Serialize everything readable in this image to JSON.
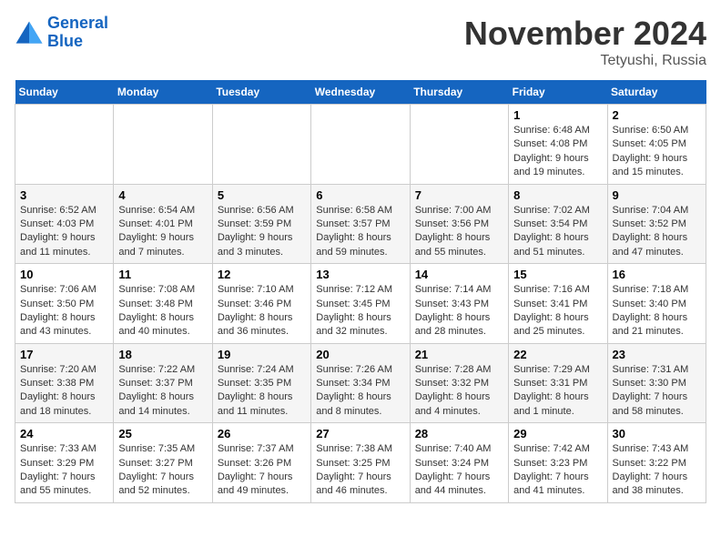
{
  "logo": {
    "line1": "General",
    "line2": "Blue"
  },
  "title": "November 2024",
  "location": "Tetyushi, Russia",
  "weekdays": [
    "Sunday",
    "Monday",
    "Tuesday",
    "Wednesday",
    "Thursday",
    "Friday",
    "Saturday"
  ],
  "weeks": [
    [
      {
        "day": "",
        "detail": ""
      },
      {
        "day": "",
        "detail": ""
      },
      {
        "day": "",
        "detail": ""
      },
      {
        "day": "",
        "detail": ""
      },
      {
        "day": "",
        "detail": ""
      },
      {
        "day": "1",
        "detail": "Sunrise: 6:48 AM\nSunset: 4:08 PM\nDaylight: 9 hours and 19 minutes."
      },
      {
        "day": "2",
        "detail": "Sunrise: 6:50 AM\nSunset: 4:05 PM\nDaylight: 9 hours and 15 minutes."
      }
    ],
    [
      {
        "day": "3",
        "detail": "Sunrise: 6:52 AM\nSunset: 4:03 PM\nDaylight: 9 hours and 11 minutes."
      },
      {
        "day": "4",
        "detail": "Sunrise: 6:54 AM\nSunset: 4:01 PM\nDaylight: 9 hours and 7 minutes."
      },
      {
        "day": "5",
        "detail": "Sunrise: 6:56 AM\nSunset: 3:59 PM\nDaylight: 9 hours and 3 minutes."
      },
      {
        "day": "6",
        "detail": "Sunrise: 6:58 AM\nSunset: 3:57 PM\nDaylight: 8 hours and 59 minutes."
      },
      {
        "day": "7",
        "detail": "Sunrise: 7:00 AM\nSunset: 3:56 PM\nDaylight: 8 hours and 55 minutes."
      },
      {
        "day": "8",
        "detail": "Sunrise: 7:02 AM\nSunset: 3:54 PM\nDaylight: 8 hours and 51 minutes."
      },
      {
        "day": "9",
        "detail": "Sunrise: 7:04 AM\nSunset: 3:52 PM\nDaylight: 8 hours and 47 minutes."
      }
    ],
    [
      {
        "day": "10",
        "detail": "Sunrise: 7:06 AM\nSunset: 3:50 PM\nDaylight: 8 hours and 43 minutes."
      },
      {
        "day": "11",
        "detail": "Sunrise: 7:08 AM\nSunset: 3:48 PM\nDaylight: 8 hours and 40 minutes."
      },
      {
        "day": "12",
        "detail": "Sunrise: 7:10 AM\nSunset: 3:46 PM\nDaylight: 8 hours and 36 minutes."
      },
      {
        "day": "13",
        "detail": "Sunrise: 7:12 AM\nSunset: 3:45 PM\nDaylight: 8 hours and 32 minutes."
      },
      {
        "day": "14",
        "detail": "Sunrise: 7:14 AM\nSunset: 3:43 PM\nDaylight: 8 hours and 28 minutes."
      },
      {
        "day": "15",
        "detail": "Sunrise: 7:16 AM\nSunset: 3:41 PM\nDaylight: 8 hours and 25 minutes."
      },
      {
        "day": "16",
        "detail": "Sunrise: 7:18 AM\nSunset: 3:40 PM\nDaylight: 8 hours and 21 minutes."
      }
    ],
    [
      {
        "day": "17",
        "detail": "Sunrise: 7:20 AM\nSunset: 3:38 PM\nDaylight: 8 hours and 18 minutes."
      },
      {
        "day": "18",
        "detail": "Sunrise: 7:22 AM\nSunset: 3:37 PM\nDaylight: 8 hours and 14 minutes."
      },
      {
        "day": "19",
        "detail": "Sunrise: 7:24 AM\nSunset: 3:35 PM\nDaylight: 8 hours and 11 minutes."
      },
      {
        "day": "20",
        "detail": "Sunrise: 7:26 AM\nSunset: 3:34 PM\nDaylight: 8 hours and 8 minutes."
      },
      {
        "day": "21",
        "detail": "Sunrise: 7:28 AM\nSunset: 3:32 PM\nDaylight: 8 hours and 4 minutes."
      },
      {
        "day": "22",
        "detail": "Sunrise: 7:29 AM\nSunset: 3:31 PM\nDaylight: 8 hours and 1 minute."
      },
      {
        "day": "23",
        "detail": "Sunrise: 7:31 AM\nSunset: 3:30 PM\nDaylight: 7 hours and 58 minutes."
      }
    ],
    [
      {
        "day": "24",
        "detail": "Sunrise: 7:33 AM\nSunset: 3:29 PM\nDaylight: 7 hours and 55 minutes."
      },
      {
        "day": "25",
        "detail": "Sunrise: 7:35 AM\nSunset: 3:27 PM\nDaylight: 7 hours and 52 minutes."
      },
      {
        "day": "26",
        "detail": "Sunrise: 7:37 AM\nSunset: 3:26 PM\nDaylight: 7 hours and 49 minutes."
      },
      {
        "day": "27",
        "detail": "Sunrise: 7:38 AM\nSunset: 3:25 PM\nDaylight: 7 hours and 46 minutes."
      },
      {
        "day": "28",
        "detail": "Sunrise: 7:40 AM\nSunset: 3:24 PM\nDaylight: 7 hours and 44 minutes."
      },
      {
        "day": "29",
        "detail": "Sunrise: 7:42 AM\nSunset: 3:23 PM\nDaylight: 7 hours and 41 minutes."
      },
      {
        "day": "30",
        "detail": "Sunrise: 7:43 AM\nSunset: 3:22 PM\nDaylight: 7 hours and 38 minutes."
      }
    ]
  ]
}
